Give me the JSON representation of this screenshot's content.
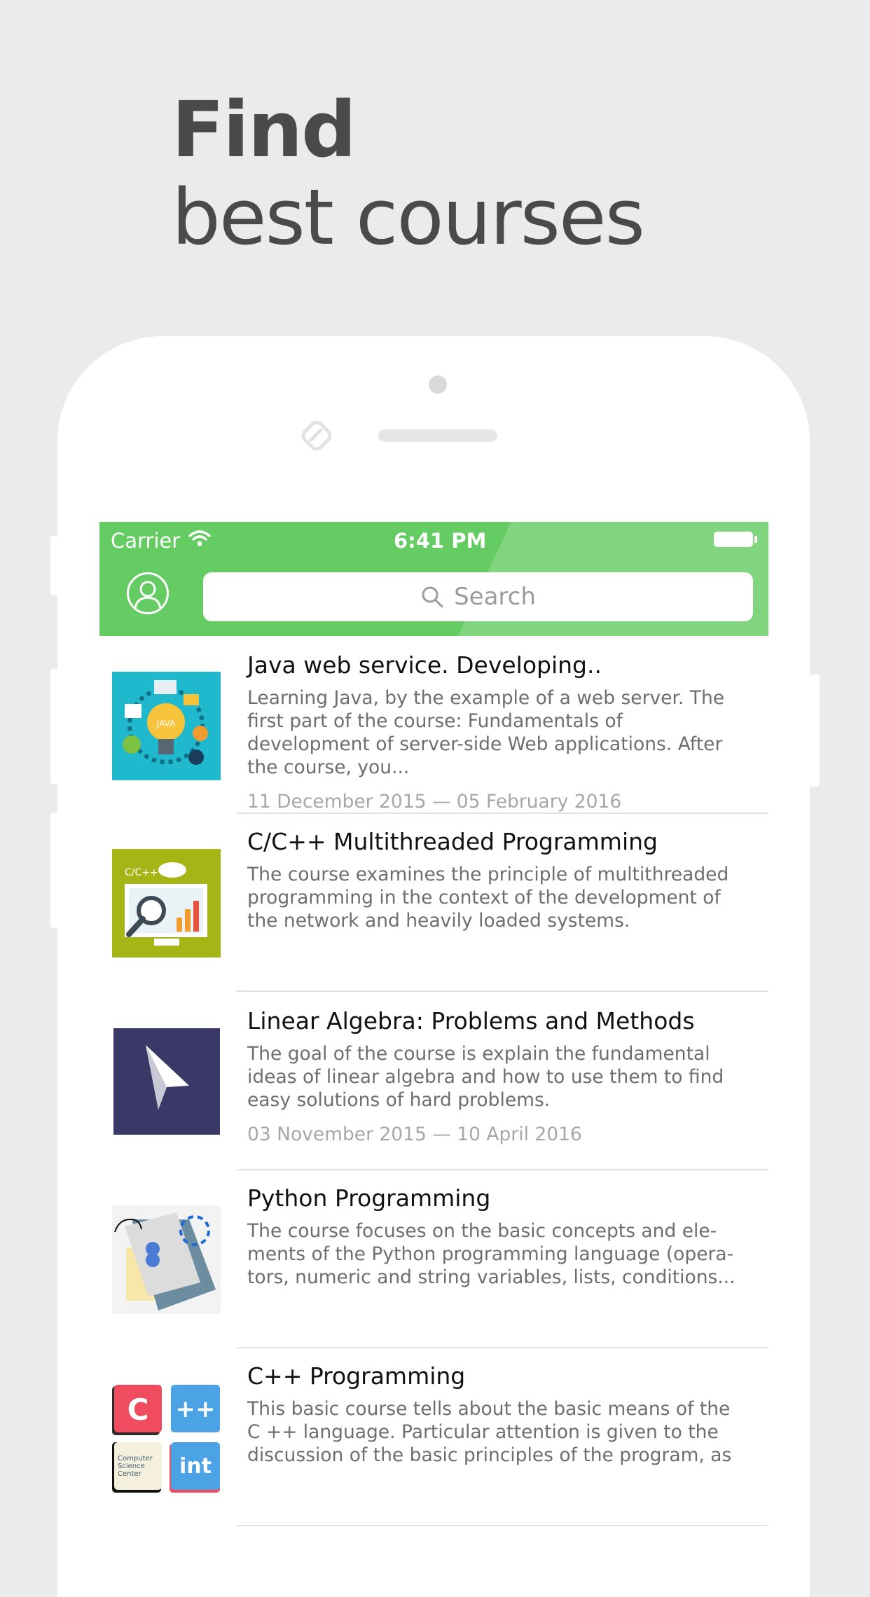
{
  "headline": {
    "line1": "Find",
    "line2": "best courses"
  },
  "status_bar": {
    "carrier": "Carrier",
    "time": "6:41 PM"
  },
  "search": {
    "placeholder": "Search"
  },
  "colors": {
    "accent": "#65cc63",
    "background": "#ebebeb"
  },
  "courses": [
    {
      "title": "Java web service. Developing..",
      "description": "Learning Java, by the example of a web server. The first part of the course: Fundamentals of development of server-side Web applications. After the course, you...",
      "dates": "11 December 2015 — 05 February 2016",
      "thumbnail": "java-lightbulb-icon"
    },
    {
      "title": "C/C++ Multithreaded Programming",
      "description": "The course examines the principle of multithreaded programming in the context of the development of the network and heavily loaded systems.",
      "thumbnail": "cpp-monitor-chart-icon",
      "thumb_label": "C/C++"
    },
    {
      "title": "Linear Algebra: Problems and Methods",
      "description": "The goal of the course is explain the fundamental ideas of linear algebra and how to use them to find easy solutions of hard problems.",
      "dates": "03 November 2015 — 10 April 2016",
      "thumbnail": "paper-plane-icon"
    },
    {
      "title": "Python Programming",
      "description": "The course focuses on the basic concepts and ele-ments of the Python programming language (opera-tors, numeric and string variables, lists, conditions...",
      "thumbnail": "python-notebook-icon"
    },
    {
      "title": "C++ Programming",
      "description": "This basic course tells about the basic means of the C ++ language. Particular attention is given to the discussion of the basic principles of the program, as",
      "thumbnail": "cpp-tiles-icon",
      "tiles": [
        "C",
        "++",
        "Computer Science Center",
        "int"
      ]
    }
  ]
}
